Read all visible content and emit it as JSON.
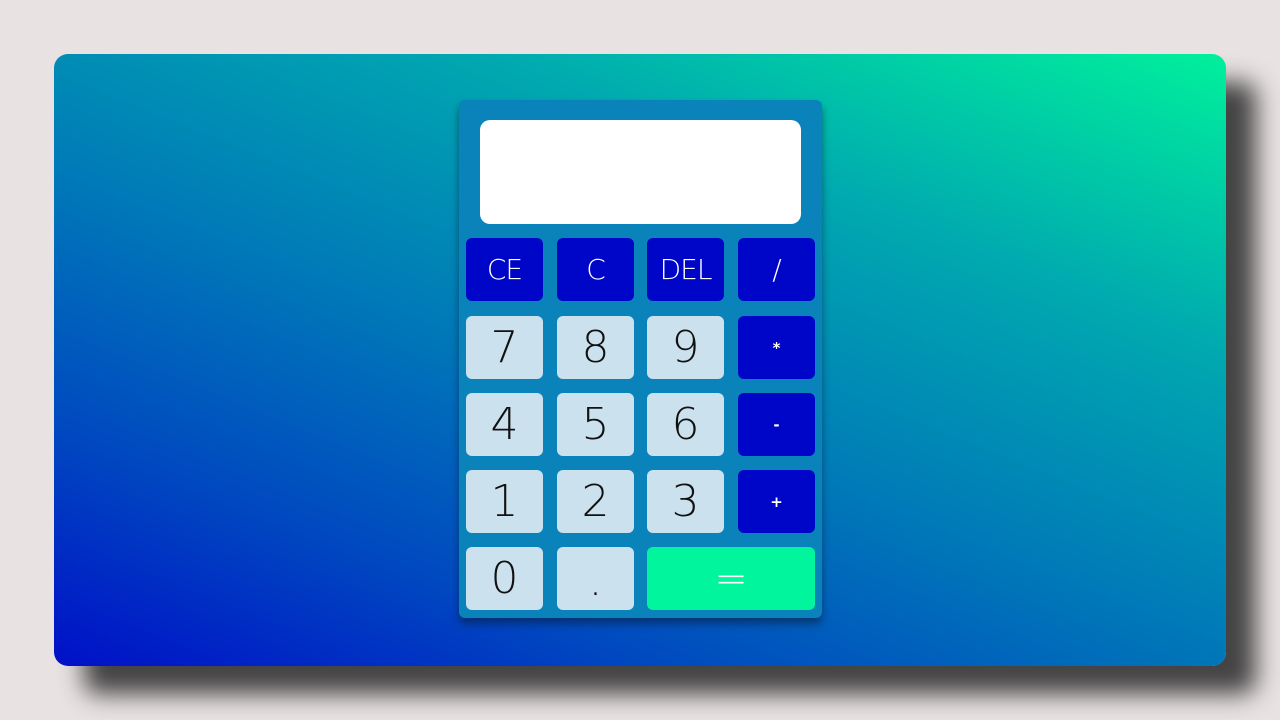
{
  "calculator": {
    "display_value": "",
    "keys": {
      "clear_entry": "CE",
      "clear": "C",
      "delete": "DEL",
      "divide": "/",
      "seven": "7",
      "eight": "8",
      "nine": "9",
      "multiply": "*",
      "four": "4",
      "five": "5",
      "six": "6",
      "subtract": "-",
      "one": "1",
      "two": "2",
      "three": "3",
      "add": "+",
      "zero": "0",
      "decimal": ".",
      "equals": "="
    }
  },
  "colors": {
    "operator_key": "#0006c8",
    "number_key": "#cce1ee",
    "equals_key": "#00f59c",
    "calculator_body": "#0a83ba",
    "display": "#ffffff"
  }
}
